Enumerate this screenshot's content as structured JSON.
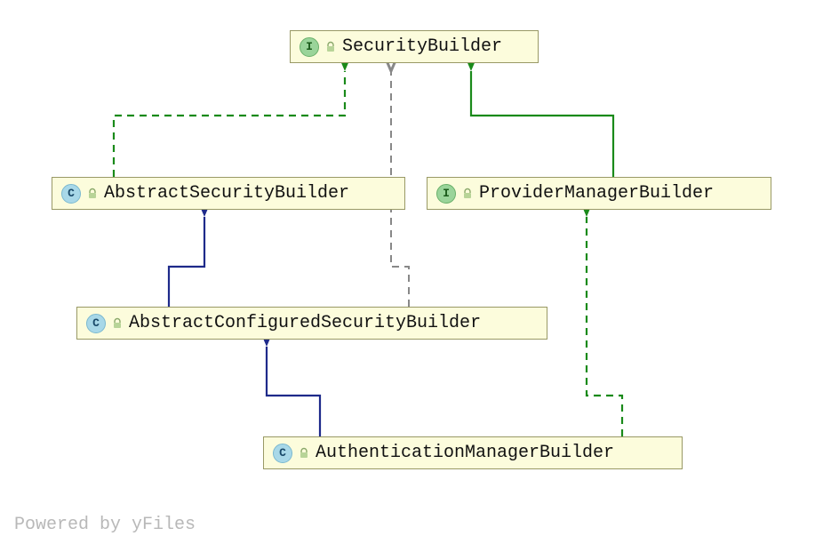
{
  "nodes": {
    "securityBuilder": {
      "kind": "I",
      "label": "SecurityBuilder"
    },
    "abstractSecurityBuilder": {
      "kind": "C",
      "label": "AbstractSecurityBuilder"
    },
    "providerManagerBuilder": {
      "kind": "I",
      "label": "ProviderManagerBuilder"
    },
    "abstractConfiguredSecurityBuilder": {
      "kind": "C",
      "label": "AbstractConfiguredSecurityBuilder"
    },
    "authenticationManagerBuilder": {
      "kind": "C",
      "label": "AuthenticationManagerBuilder"
    }
  },
  "edges": [
    {
      "from": "abstractSecurityBuilder",
      "to": "securityBuilder",
      "style": "implements"
    },
    {
      "from": "providerManagerBuilder",
      "to": "securityBuilder",
      "style": "extends-interface"
    },
    {
      "from": "abstractConfiguredSecurityBuilder",
      "to": "securityBuilder",
      "style": "dependency"
    },
    {
      "from": "abstractConfiguredSecurityBuilder",
      "to": "abstractSecurityBuilder",
      "style": "extends-class"
    },
    {
      "from": "authenticationManagerBuilder",
      "to": "abstractConfiguredSecurityBuilder",
      "style": "extends-class"
    },
    {
      "from": "authenticationManagerBuilder",
      "to": "providerManagerBuilder",
      "style": "implements"
    }
  ],
  "footer": "Powered by yFiles",
  "colors": {
    "nodeFill": "#fcfcdc",
    "nodeBorder": "#999966",
    "extendsClass": "#1e2a8a",
    "extendsInterface": "#1a8a1a",
    "implements": "#1a8a1a",
    "dependency": "#888888"
  }
}
